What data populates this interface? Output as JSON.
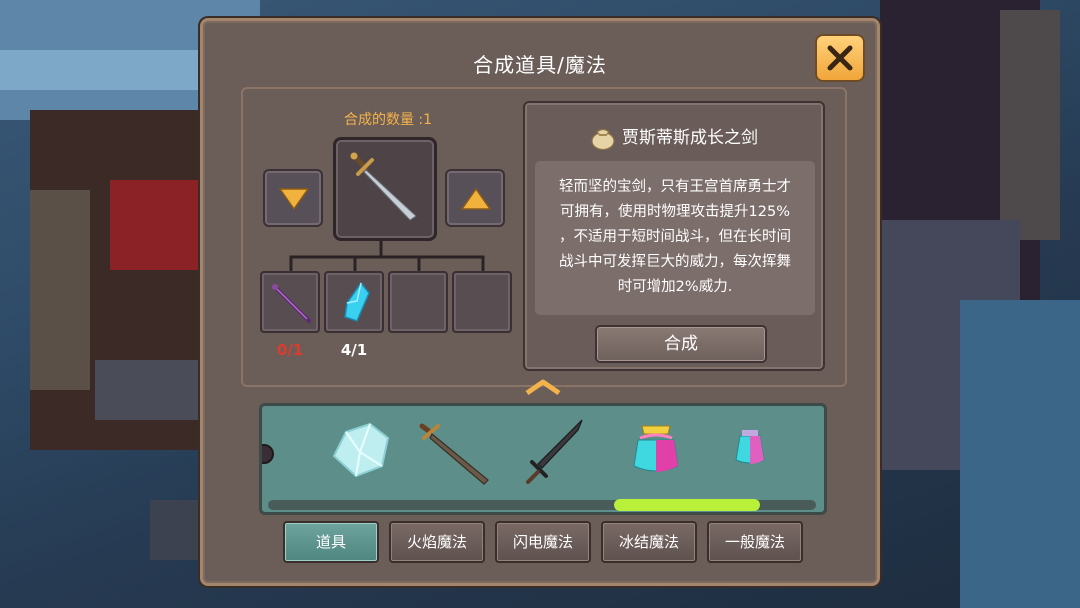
{
  "panel": {
    "title": "合成道具/魔法",
    "close_icon": "close-x-icon"
  },
  "crafting": {
    "quantity_label": "合成的数量 :1",
    "decrease_icon": "triangle-down-icon",
    "increase_icon": "triangle-up-icon",
    "target_item_icon": "sword-icon",
    "materials": [
      {
        "icon": "purple-staff-icon",
        "count": "0/1",
        "count_color": "#e03a2e"
      },
      {
        "icon": "blue-crystal-icon",
        "count": "4/1",
        "count_color": "#ffffff"
      },
      {
        "icon": "",
        "count": ""
      },
      {
        "icon": "",
        "count": ""
      }
    ]
  },
  "info": {
    "item_icon": "money-bag-icon",
    "item_name": "贾斯蒂斯成长之剑",
    "description_lines": [
      "轻而坚的宝剑，只有王宫首席勇士才",
      "可拥有，使用时物理攻击提升125%",
      "，不适用于短时间战斗，但在长时间",
      "战斗中可发挥巨大的威力，每次挥舞",
      "时可增加2%威力."
    ],
    "craft_button": "合成"
  },
  "inventory": {
    "items": [
      "ice-crystal-icon",
      "bronze-sword-icon",
      "dark-sword-icon",
      "pink-cyan-potion-icon",
      "small-potion-icon"
    ],
    "scroll_position": 0.7
  },
  "tabs": [
    {
      "label": "道具",
      "active": true
    },
    {
      "label": "火焰魔法",
      "active": false
    },
    {
      "label": "闪电魔法",
      "active": false
    },
    {
      "label": "冰结魔法",
      "active": false
    },
    {
      "label": "一般魔法",
      "active": false
    }
  ],
  "colors": {
    "panel_bg": "#6b5e58",
    "accent_gold": "#f4b24a",
    "inventory_bg": "#5e8e8a",
    "scroll_thumb": "#b8f03a",
    "active_tab": "#4f8680"
  }
}
